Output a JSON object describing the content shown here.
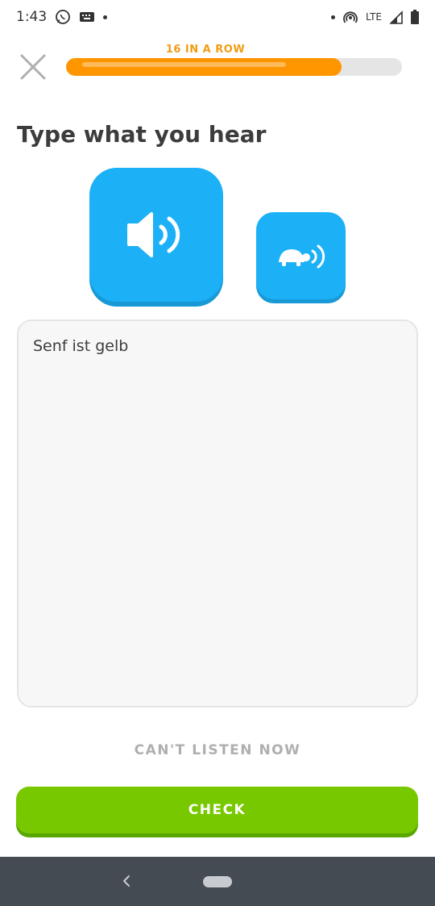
{
  "status_bar": {
    "time": "1:43",
    "network_label": "LTE",
    "icons": [
      "whatsapp-icon",
      "keyboard-icon",
      "dot-icon",
      "hotspot-icon",
      "signal-icon",
      "battery-icon"
    ]
  },
  "header": {
    "streak_label": "16 IN A ROW",
    "progress": 0.82,
    "close_icon": "close-icon"
  },
  "challenge": {
    "title": "Type what you hear",
    "speak_button_icon": "speaker-icon",
    "slow_button_icon": "turtle-speaker-icon"
  },
  "answer": {
    "value": "Senf ist gelb"
  },
  "actions": {
    "cant_listen_label": "CAN'T LISTEN NOW",
    "check_label": "CHECK"
  },
  "colors": {
    "accent_blue": "#1cb0f6",
    "accent_green": "#78c800",
    "streak_orange": "#ff9600"
  },
  "nav_bar": {
    "icons": [
      "back-icon",
      "home-pill-icon"
    ]
  }
}
